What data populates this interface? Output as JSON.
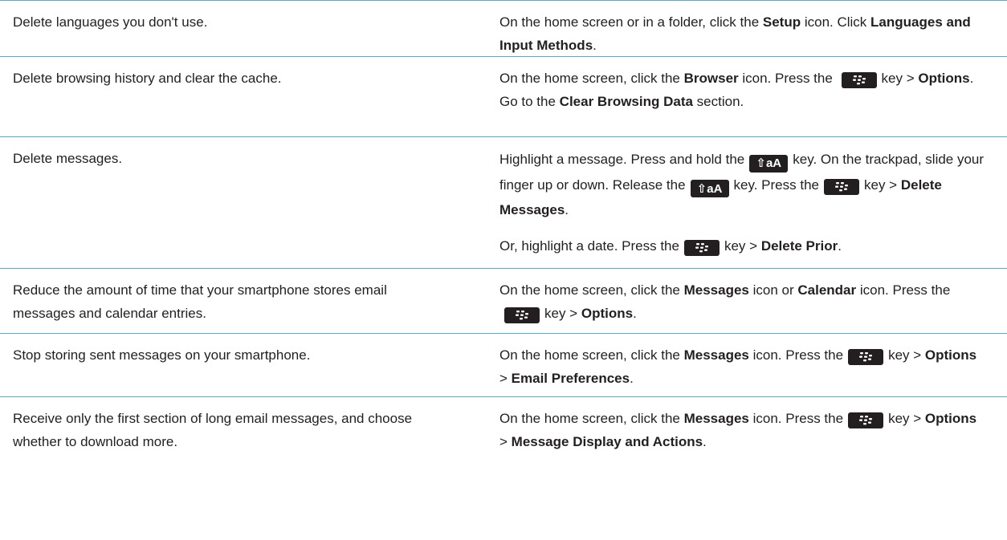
{
  "rows": [
    {
      "tip": "Delete languages you don't use.",
      "steps": {
        "p1": [
          "On the home screen or in a folder, click the ",
          "Setup",
          " icon. Click ",
          "Languages and Input Methods",
          "."
        ]
      }
    },
    {
      "tip": "Delete browsing history and clear the cache.",
      "steps": {
        "p1": [
          "On the home screen, click the ",
          "Browser",
          " icon. Press the",
          "key > ",
          "Options",
          ". Go to the ",
          "Clear Browsing Data",
          " section."
        ]
      }
    },
    {
      "tip": "Delete messages.",
      "steps": {
        "p1": [
          "Highlight a message. Press and hold the",
          "key. On the trackpad, slide your finger up or down. Release the",
          "key. Press the",
          "key > ",
          "Delete Messages",
          "."
        ],
        "p2": [
          "Or, highlight a date. Press the",
          "key > ",
          "Delete Prior",
          "."
        ]
      }
    },
    {
      "tip": "Reduce the amount of time that your smartphone stores email messages and calendar entries.",
      "steps": {
        "p1": [
          "On the home screen, click the ",
          "Messages",
          " icon or ",
          "Calendar",
          " icon. Press the",
          "key > ",
          "Options",
          "."
        ]
      }
    },
    {
      "tip": "Stop storing sent messages on your smartphone.",
      "steps": {
        "p1": [
          "On the home screen, click the ",
          "Messages",
          " icon. Press the",
          "key > ",
          "Options",
          " > ",
          "Email Preferences",
          "."
        ]
      }
    },
    {
      "tip": "Receive only the first section of long email messages, and choose whether to download more.",
      "steps": {
        "p1": [
          "On the home screen, click the ",
          "Messages",
          " icon. Press the",
          "key > ",
          "Options",
          " > ",
          "Message Display and Actions",
          "."
        ]
      }
    }
  ],
  "shift_key_label": "⇧aA",
  "icons": {
    "menu_key": "blackberry-menu-key-icon",
    "shift_key": "alt-shift-key-icon"
  },
  "colors": {
    "rule": "#5aa7c6",
    "text": "#231f20",
    "key_bg": "#231f20"
  }
}
